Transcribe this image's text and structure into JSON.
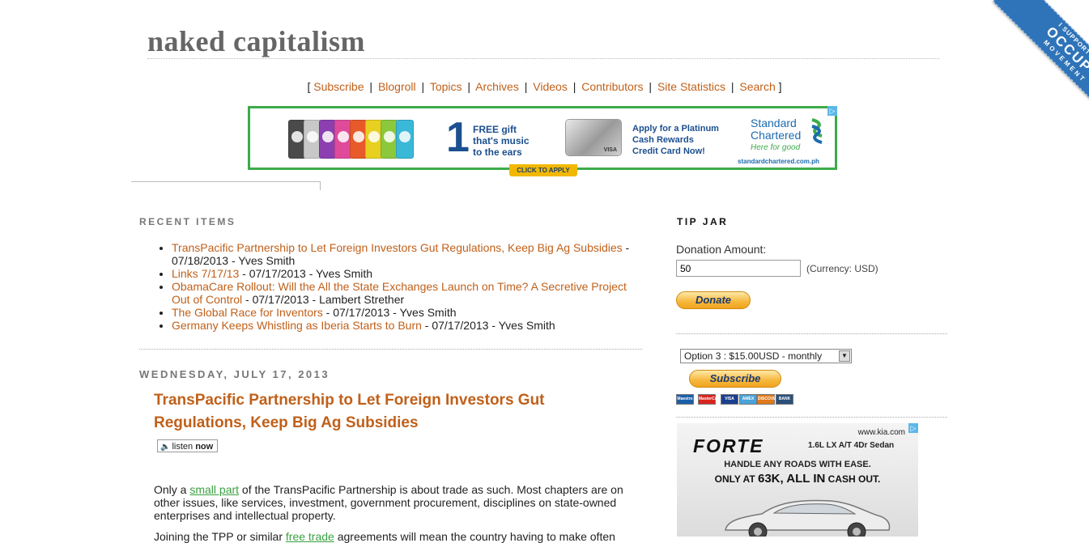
{
  "site": {
    "title": "naked capitalism"
  },
  "nav": {
    "open_bracket": "[",
    "close_bracket": "]",
    "items": [
      "Subscribe",
      "Blogroll",
      "Topics",
      "Archives",
      "Videos",
      "Contributors",
      "Site Statistics",
      "Search"
    ],
    "separator": "|"
  },
  "top_ad": {
    "free_gift_lines": [
      "FREE gift",
      "that's music",
      "to the ears"
    ],
    "big_number": "1",
    "platinum_lines": [
      "Apply for a Platinum",
      "Cash Rewards",
      "Credit Card Now!"
    ],
    "brand_lines": [
      "Standard",
      "Chartered"
    ],
    "brand_tagline": "Here for good",
    "url": "standardchartered.com.ph",
    "cta": "CLICK TO APPLY",
    "ipod_colors": [
      "#4a4a4a",
      "#c8c8c8",
      "#8b3fb0",
      "#e04a9a",
      "#e85a2a",
      "#e8d020",
      "#8cc83c",
      "#3ab8d8"
    ]
  },
  "recent": {
    "heading": "RECENT ITEMS",
    "items": [
      {
        "title": "TransPacific Partnership to Let Foreign Investors Gut Regulations, Keep Big Ag Subsidies",
        "meta": " - 07/18/2013 - Yves Smith"
      },
      {
        "title": "Links 7/17/13",
        "meta": " - 07/17/2013 - Yves Smith"
      },
      {
        "title": "ObamaCare Rollout: Will the All the State Exchanges Launch on Time? A Secretive Project Out of Control",
        "meta": " - 07/17/2013 - Lambert Strether"
      },
      {
        "title": "The Global Race for Inventors",
        "meta": " - 07/17/2013 - Yves Smith"
      },
      {
        "title": "Germany Keeps Whistling as Iberia Starts to Burn",
        "meta": " - 07/17/2013 - Yves Smith"
      }
    ]
  },
  "post": {
    "date": "WEDNESDAY, JULY 17, 2013",
    "title": "TransPacific Partnership to Let Foreign Investors Gut Regulations, Keep Big Ag Subsidies",
    "listen_label": "listen",
    "listen_now": "now",
    "p1_before": "Only a ",
    "p1_link": "small part",
    "p1_after": " of the TransPacific Partnership is about trade as such. Most chapters are on other issues, like services, investment, government procurement, disciplines on state-owned enterprises and intellectual property.",
    "p2_before": "Joining the TPP or similar ",
    "p2_link": "free trade",
    "p2_after": " agreements will mean the country having to make often"
  },
  "tip_jar": {
    "heading": "TIP JAR",
    "donation_label": "Donation Amount:",
    "donation_value": "50",
    "currency": "(Currency: USD)",
    "donate_label": "Donate",
    "option_selected": "Option 3 : $15.00USD - monthly",
    "subscribe_label": "Subscribe",
    "cards": [
      {
        "name": "Maestro",
        "color": "#1b5fa8"
      },
      {
        "name": "MasterCard",
        "color": "#d9251d"
      },
      {
        "name": "VISA",
        "color": "#1a3f8f"
      },
      {
        "name": "AMEX",
        "color": "#4aa3d8"
      },
      {
        "name": "DISCOVER",
        "color": "#e07a1a"
      },
      {
        "name": "BANK",
        "color": "#2a4f7a"
      }
    ]
  },
  "kia_ad": {
    "url": "www.kia.com",
    "model": "FORTE",
    "spec": "1.6L LX A/T 4Dr Sedan",
    "line1": "HANDLE ANY ROADS WITH EASE.",
    "line2_pre": "ONLY AT ",
    "line2_big": "63K, ALL IN",
    "line2_post": " CASH OUT."
  },
  "ribbon": {
    "line1": "I SUPPORT THE",
    "line2": "OCCUPY",
    "line3": "MOVEMENT"
  }
}
